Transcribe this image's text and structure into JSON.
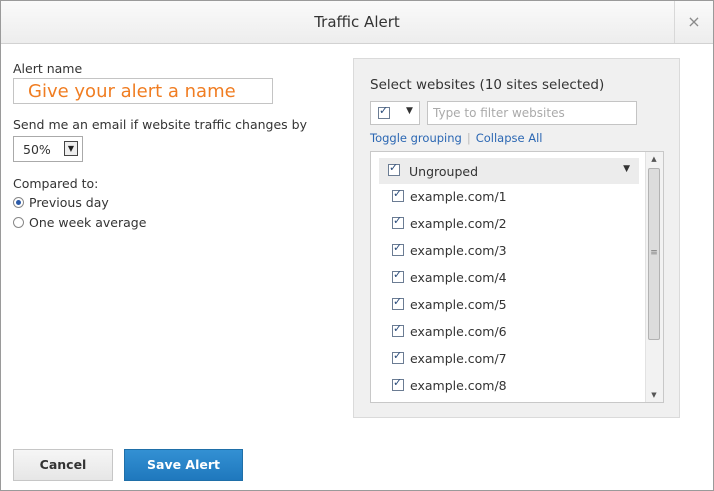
{
  "dialog": {
    "title": "Traffic Alert",
    "close_glyph": "×"
  },
  "alert_name": {
    "label": "Alert name",
    "placeholder": "Give your alert a name",
    "value": ""
  },
  "email_threshold": {
    "label": "Send me an email if website traffic changes by",
    "selected": "50%"
  },
  "compare": {
    "label": "Compared to:",
    "options": [
      {
        "label": "Previous day",
        "selected": true
      },
      {
        "label": "One week average",
        "selected": false
      }
    ]
  },
  "websites": {
    "title": "Select websites (10 sites selected)",
    "filter_placeholder": "Type to filter websites",
    "toggle_grouping": "Toggle grouping",
    "collapse_all": "Collapse All",
    "group_label": "Ungrouped",
    "items": [
      {
        "label": "example.com/1",
        "checked": true
      },
      {
        "label": "example.com/2",
        "checked": true
      },
      {
        "label": "example.com/3",
        "checked": true
      },
      {
        "label": "example.com/4",
        "checked": true
      },
      {
        "label": "example.com/5",
        "checked": true
      },
      {
        "label": "example.com/6",
        "checked": true
      },
      {
        "label": "example.com/7",
        "checked": true
      },
      {
        "label": "example.com/8",
        "checked": true
      }
    ]
  },
  "buttons": {
    "cancel": "Cancel",
    "save": "Save Alert"
  },
  "colors": {
    "accent": "#1f78bd",
    "name_placeholder": "#f07d22",
    "link": "#2b67b3"
  }
}
